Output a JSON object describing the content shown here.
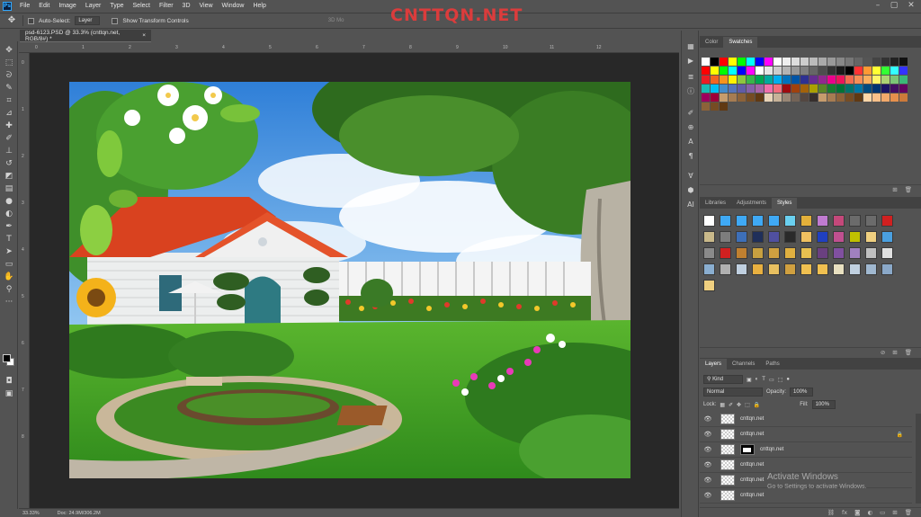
{
  "app": {
    "logo_text": "Ps",
    "menus": [
      "File",
      "Edit",
      "Image",
      "Layer",
      "Type",
      "Select",
      "Filter",
      "3D",
      "View",
      "Window",
      "Help"
    ],
    "watermark": "CNTTQN.NET"
  },
  "options": {
    "auto_select_label": "Auto-Select:",
    "auto_select_value": "Layer",
    "transform_label": "Show Transform Controls",
    "mode_label": "3D Mo"
  },
  "document": {
    "tab_title": "psd-6123.PSD @ 33.3% (cnttqn.net, RGB/8#) *",
    "close_glyph": "×"
  },
  "rulers": {
    "horizontal": [
      "0",
      "1",
      "2",
      "3",
      "4",
      "5",
      "6",
      "7",
      "8",
      "9",
      "10",
      "11",
      "12"
    ],
    "vertical": [
      "0",
      "1",
      "2",
      "3",
      "4",
      "5",
      "6",
      "7",
      "8"
    ]
  },
  "status": {
    "zoom": "33.33%",
    "doc": "Doc: 24.9M/306.2M"
  },
  "tools": [
    "move-tool",
    "marquee-tool",
    "lasso-tool",
    "quick-select-tool",
    "crop-tool",
    "eyedropper-tool",
    "healing-tool",
    "brush-tool",
    "stamp-tool",
    "history-brush-tool",
    "eraser-tool",
    "gradient-tool",
    "blur-tool",
    "dodge-tool",
    "pen-tool",
    "type-tool",
    "path-select-tool",
    "shape-tool",
    "hand-tool",
    "zoom-tool"
  ],
  "color_panel": {
    "tabs": [
      "Color",
      "Swatches"
    ],
    "active_tab": "Swatches",
    "swatches": [
      "#ffffff",
      "#000000",
      "#ff0000",
      "#ffff00",
      "#00ff00",
      "#00ffff",
      "#0000ff",
      "#ff00ff",
      "#ffffff",
      "#eeeeee",
      "#dddddd",
      "#cccccc",
      "#bbbbbb",
      "#aaaaaa",
      "#999999",
      "#888888",
      "#777777",
      "#666666",
      "#555555",
      "#444444",
      "#333333",
      "#222222",
      "#111111",
      "#ff0000",
      "#ffff00",
      "#00ff00",
      "#00ffff",
      "#0000ff",
      "#ff00ff",
      "#ffffff",
      "#e6e6e6",
      "#cccccc",
      "#b3b3b3",
      "#999999",
      "#808080",
      "#666666",
      "#4d4d4d",
      "#333333",
      "#1a1a1a",
      "#000000",
      "#ff3333",
      "#ff9933",
      "#ffff33",
      "#33ff33",
      "#33ffff",
      "#3333ff",
      "#ed1c24",
      "#f26522",
      "#f7941d",
      "#fff200",
      "#8dc63f",
      "#39b54a",
      "#00a651",
      "#00a99d",
      "#00aeef",
      "#0072bc",
      "#0054a6",
      "#2e3192",
      "#662d91",
      "#92278f",
      "#ec008c",
      "#ed145b",
      "#f26c4f",
      "#f68e56",
      "#fbaf5d",
      "#fff568",
      "#acd373",
      "#7cc576",
      "#3bb878",
      "#1abbb4",
      "#00bff3",
      "#438ccb",
      "#5674b9",
      "#605ca8",
      "#8560a8",
      "#a864a8",
      "#f06eaa",
      "#f26d7d",
      "#9e0b0f",
      "#a0410d",
      "#a3620a",
      "#aba000",
      "#598527",
      "#197b30",
      "#007236",
      "#00746b",
      "#0076a3",
      "#004b80",
      "#003471",
      "#1b1464",
      "#440e62",
      "#630460",
      "#9e005d",
      "#9e0039",
      "#c69c6d",
      "#a67c52",
      "#8c6239",
      "#754c24",
      "#603913",
      "#e8d4b8",
      "#c7b299",
      "#998675",
      "#736357",
      "#534741",
      "#362f2d",
      "#c69c6d",
      "#a67c52",
      "#8c6239",
      "#754c24",
      "#603913",
      "#ffd6a8",
      "#f9c08a",
      "#f2a96b",
      "#e6904c",
      "#cc7a3a",
      "#8c6239",
      "#754c24",
      "#603913"
    ]
  },
  "styles_panel": {
    "tabs": [
      "Libraries",
      "Adjustments",
      "Styles"
    ],
    "active_tab": "Styles",
    "items": [
      "#ffffff",
      "#3fa9f5",
      "#3fa9f5",
      "#3fa9f5",
      "#3fa9f5",
      "#6ad0f0",
      "#e3b03a",
      "#c07bd0",
      "#c4487a",
      "#6b6b6b",
      "#6b6b6b",
      "#d02020",
      "#c9b98a",
      "#7d7d7d",
      "#3d6fb8",
      "#1f2f5a",
      "#5050a0",
      "#2a2a2a",
      "#f0c060",
      "#2040c0",
      "#c05090",
      "#c0c000",
      "#f0d080",
      "#4aa0e0",
      "#8a8a8a",
      "#d02020",
      "#c08030",
      "#c8a040",
      "#d0a040",
      "#e0b040",
      "#e8c050",
      "#6a4080",
      "#8050a0",
      "#a080c0",
      "#c0c0c0",
      "#e0e0e0",
      "#8aaed0",
      "#b0b0b0",
      "#c0d0e0",
      "#e8b040",
      "#e8c060",
      "#d0a040",
      "#f0c050",
      "#f0c050",
      "#e8e0c0",
      "#c0d0e0",
      "#a0b8d0",
      "#8aa8c8",
      "#f0d080"
    ]
  },
  "layers_panel": {
    "tabs": [
      "Layers",
      "Channels",
      "Paths"
    ],
    "active_tab": "Layers",
    "kind_label": "Kind",
    "blend_mode": "Normal",
    "opacity_label": "Opacity:",
    "opacity_value": "100%",
    "lock_label": "Lock:",
    "fill_label": "Fill:",
    "fill_value": "100%",
    "layers": [
      {
        "name": "cnttqn.net",
        "mask": false,
        "lock": false
      },
      {
        "name": "cnttqn.net",
        "mask": false,
        "lock": true
      },
      {
        "name": "cnttqn.net",
        "mask": true,
        "lock": false
      },
      {
        "name": "cnttqn.net",
        "mask": false,
        "lock": false
      },
      {
        "name": "cnttqn.net",
        "mask": false,
        "lock": false
      },
      {
        "name": "cnttqn.net",
        "mask": false,
        "lock": false
      },
      {
        "name": "cnttqn.net",
        "mask": false,
        "lock": false
      }
    ]
  },
  "activation": {
    "title": "Activate Windows",
    "subtitle": "Go to Settings to activate Windows."
  }
}
